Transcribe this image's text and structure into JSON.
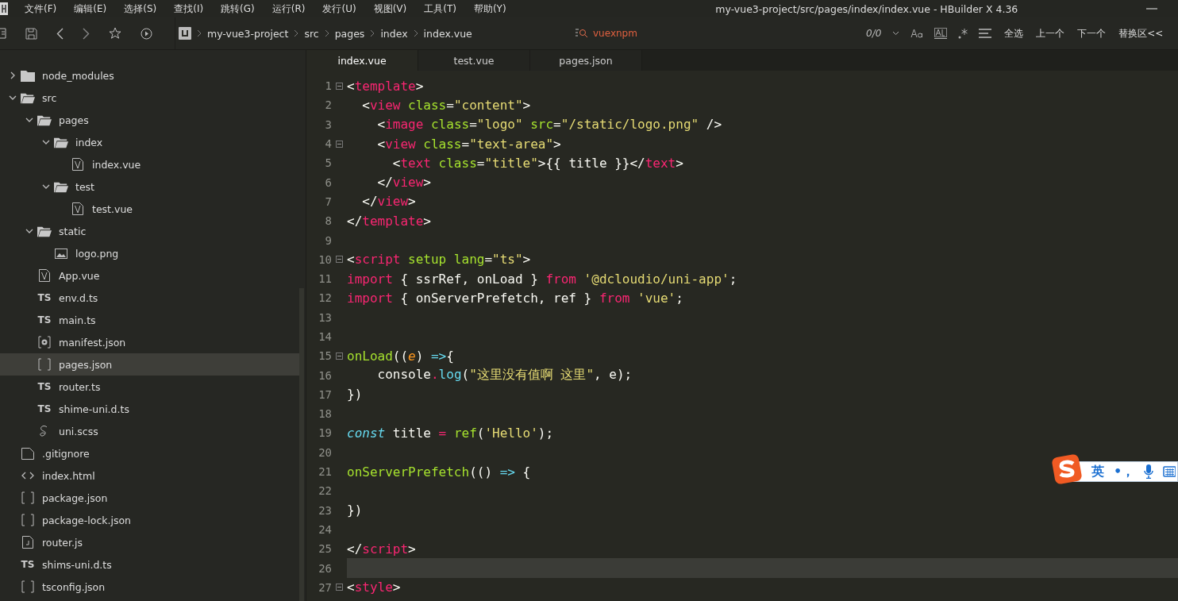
{
  "window": {
    "title": "my-vue3-project/src/pages/index/index.vue - HBuilder X 4.36"
  },
  "menu": [
    "文件(F)",
    "编辑(E)",
    "选择(S)",
    "查找(I)",
    "跳转(G)",
    "运行(R)",
    "发行(U)",
    "视图(V)",
    "工具(T)",
    "帮助(Y)"
  ],
  "breadcrumb": [
    "my-vue3-project",
    "src",
    "pages",
    "index",
    "index.vue"
  ],
  "find": {
    "value": "vuexnpm",
    "count": "0/0",
    "buttons": [
      "全选",
      "上一个",
      "下一个",
      "替换区<<"
    ]
  },
  "tree": [
    {
      "name": "node_modules",
      "kind": "folder",
      "expanded": false,
      "selected": false
    },
    {
      "name": "src",
      "kind": "folder",
      "expanded": true,
      "selected": false,
      "children": [
        {
          "name": "pages",
          "kind": "folder",
          "expanded": true,
          "selected": false,
          "children": [
            {
              "name": "index",
              "kind": "folder",
              "expanded": true,
              "selected": false,
              "children": [
                {
                  "name": "index.vue",
                  "kind": "vue",
                  "selected": false
                }
              ]
            },
            {
              "name": "test",
              "kind": "folder",
              "expanded": true,
              "selected": false,
              "children": [
                {
                  "name": "test.vue",
                  "kind": "vue",
                  "selected": false
                }
              ]
            }
          ]
        },
        {
          "name": "static",
          "kind": "folder",
          "expanded": true,
          "selected": false,
          "children": [
            {
              "name": "logo.png",
              "kind": "image",
              "selected": false
            }
          ]
        },
        {
          "name": "App.vue",
          "kind": "vue",
          "selected": false
        },
        {
          "name": "env.d.ts",
          "kind": "ts",
          "badge": "TS",
          "selected": false
        },
        {
          "name": "main.ts",
          "kind": "ts",
          "badge": "TS",
          "selected": false
        },
        {
          "name": "manifest.json",
          "kind": "settings",
          "selected": false
        },
        {
          "name": "pages.json",
          "kind": "json",
          "selected": true
        },
        {
          "name": "router.ts",
          "kind": "ts",
          "badge": "TS",
          "selected": false
        },
        {
          "name": "shime-uni.d.ts",
          "kind": "ts",
          "badge": "TS",
          "selected": false
        },
        {
          "name": "uni.scss",
          "kind": "sass",
          "selected": false
        }
      ]
    },
    {
      "name": ".gitignore",
      "kind": "file",
      "selected": false
    },
    {
      "name": "index.html",
      "kind": "html",
      "selected": false
    },
    {
      "name": "package.json",
      "kind": "json",
      "selected": false
    },
    {
      "name": "package-lock.json",
      "kind": "json",
      "selected": false
    },
    {
      "name": "router.js",
      "kind": "js",
      "selected": false
    },
    {
      "name": "shims-uni.d.ts",
      "kind": "ts",
      "badge": "TS",
      "selected": false
    },
    {
      "name": "tsconfig.json",
      "kind": "json",
      "selected": false
    }
  ],
  "tabs": [
    {
      "label": "index.vue",
      "selected": true
    },
    {
      "label": "test.vue",
      "selected": false
    },
    {
      "label": "pages.json",
      "selected": false
    }
  ],
  "code": [
    {
      "number": "1",
      "fold": true,
      "tokens": [
        {
          "kind": "p",
          "text": "<"
        },
        {
          "kind": "tag",
          "text": "template"
        },
        {
          "kind": "p",
          "text": ">"
        }
      ]
    },
    {
      "number": "2",
      "tokens": [
        {
          "kind": "p",
          "text": "  <"
        },
        {
          "kind": "tag",
          "text": "view"
        },
        {
          "kind": "attr",
          "text": " class"
        },
        {
          "kind": "p",
          "text": "="
        },
        {
          "kind": "str",
          "text": "\"content\""
        },
        {
          "kind": "p",
          "text": ">"
        }
      ]
    },
    {
      "number": "3",
      "tokens": [
        {
          "kind": "p",
          "text": "    <"
        },
        {
          "kind": "tag",
          "text": "image"
        },
        {
          "kind": "attr",
          "text": " class"
        },
        {
          "kind": "p",
          "text": "="
        },
        {
          "kind": "str",
          "text": "\"logo\""
        },
        {
          "kind": "attr",
          "text": " src"
        },
        {
          "kind": "p",
          "text": "="
        },
        {
          "kind": "str",
          "text": "\"/static/logo.png\""
        },
        {
          "kind": "p",
          "text": " />"
        }
      ]
    },
    {
      "number": "4",
      "fold": true,
      "tokens": [
        {
          "kind": "p",
          "text": "    <"
        },
        {
          "kind": "tag",
          "text": "view"
        },
        {
          "kind": "attr",
          "text": " class"
        },
        {
          "kind": "p",
          "text": "="
        },
        {
          "kind": "str",
          "text": "\"text-area\""
        },
        {
          "kind": "p",
          "text": ">"
        }
      ]
    },
    {
      "number": "5",
      "tokens": [
        {
          "kind": "p",
          "text": "      <"
        },
        {
          "kind": "tag",
          "text": "text"
        },
        {
          "kind": "attr",
          "text": " class"
        },
        {
          "kind": "p",
          "text": "="
        },
        {
          "kind": "str",
          "text": "\"title\""
        },
        {
          "kind": "p",
          "text": ">{{ title }}</"
        },
        {
          "kind": "tag",
          "text": "text"
        },
        {
          "kind": "p",
          "text": ">"
        }
      ]
    },
    {
      "number": "6",
      "tokens": [
        {
          "kind": "p",
          "text": "    </"
        },
        {
          "kind": "tag",
          "text": "view"
        },
        {
          "kind": "p",
          "text": ">"
        }
      ]
    },
    {
      "number": "7",
      "tokens": [
        {
          "kind": "p",
          "text": "  </"
        },
        {
          "kind": "tag",
          "text": "view"
        },
        {
          "kind": "p",
          "text": ">"
        }
      ]
    },
    {
      "number": "8",
      "tokens": [
        {
          "kind": "p",
          "text": "</"
        },
        {
          "kind": "tag",
          "text": "template"
        },
        {
          "kind": "p",
          "text": ">"
        }
      ]
    },
    {
      "number": "9"
    },
    {
      "number": "10",
      "fold": true,
      "tokens": [
        {
          "kind": "p",
          "text": "<"
        },
        {
          "kind": "tag",
          "text": "script"
        },
        {
          "kind": "attr",
          "text": " setup lang"
        },
        {
          "kind": "p",
          "text": "="
        },
        {
          "kind": "str",
          "text": "\"ts\""
        },
        {
          "kind": "p",
          "text": ">"
        }
      ]
    },
    {
      "number": "11",
      "tokens": [
        {
          "kind": "kw",
          "text": "import"
        },
        {
          "kind": "p",
          "text": " { ssrRef, onLoad } "
        },
        {
          "kind": "kw",
          "text": "from"
        },
        {
          "kind": "str",
          "text": " '@dcloudio/uni-app'"
        },
        {
          "kind": "p",
          "text": ";"
        }
      ]
    },
    {
      "number": "12",
      "tokens": [
        {
          "kind": "kw",
          "text": "import"
        },
        {
          "kind": "p",
          "text": " { onServerPrefetch, ref } "
        },
        {
          "kind": "kw",
          "text": "from"
        },
        {
          "kind": "str",
          "text": " 'vue'"
        },
        {
          "kind": "p",
          "text": ";"
        }
      ]
    },
    {
      "number": "13"
    },
    {
      "number": "14"
    },
    {
      "number": "15",
      "fold": true,
      "tokens": [
        {
          "kind": "fn",
          "text": "onLoad"
        },
        {
          "kind": "p",
          "text": "(("
        },
        {
          "kind": "param",
          "text": "e"
        },
        {
          "kind": "p",
          "text": ") "
        },
        {
          "kind": "op",
          "text": "=>"
        },
        {
          "kind": "p",
          "text": "{"
        }
      ]
    },
    {
      "number": "16",
      "tokens": [
        {
          "kind": "p",
          "text": "    console"
        },
        {
          "kind": "tag",
          "text": "."
        },
        {
          "kind": "op",
          "text": "log"
        },
        {
          "kind": "p",
          "text": "("
        },
        {
          "kind": "str",
          "text": "\"这里没有值啊 这里\""
        },
        {
          "kind": "p",
          "text": ", e);"
        }
      ]
    },
    {
      "number": "17",
      "tokens": [
        {
          "kind": "p",
          "text": "})"
        }
      ]
    },
    {
      "number": "18"
    },
    {
      "number": "19",
      "tokens": [
        {
          "kind": "storage",
          "text": "const"
        },
        {
          "kind": "p",
          "text": " title "
        },
        {
          "kind": "tag",
          "text": "="
        },
        {
          "kind": "fn",
          "text": " ref"
        },
        {
          "kind": "p",
          "text": "("
        },
        {
          "kind": "str",
          "text": "'Hello'"
        },
        {
          "kind": "p",
          "text": ");"
        }
      ]
    },
    {
      "number": "20"
    },
    {
      "number": "21",
      "tokens": [
        {
          "kind": "fn",
          "text": "onServerPrefetch"
        },
        {
          "kind": "p",
          "text": "(() "
        },
        {
          "kind": "op",
          "text": "=>"
        },
        {
          "kind": "p",
          "text": " {"
        }
      ]
    },
    {
      "number": "22"
    },
    {
      "number": "23",
      "tokens": [
        {
          "kind": "p",
          "text": "})"
        }
      ]
    },
    {
      "number": "24"
    },
    {
      "number": "25",
      "tokens": [
        {
          "kind": "p",
          "text": "</"
        },
        {
          "kind": "tag",
          "text": "script"
        },
        {
          "kind": "p",
          "text": ">"
        }
      ]
    },
    {
      "number": "26",
      "current": true
    },
    {
      "number": "27",
      "fold": true,
      "tokens": [
        {
          "kind": "p",
          "text": "<"
        },
        {
          "kind": "tag",
          "text": "style"
        },
        {
          "kind": "p",
          "text": ">"
        }
      ]
    }
  ],
  "ime": {
    "mode": "英",
    "punct": "•，"
  }
}
